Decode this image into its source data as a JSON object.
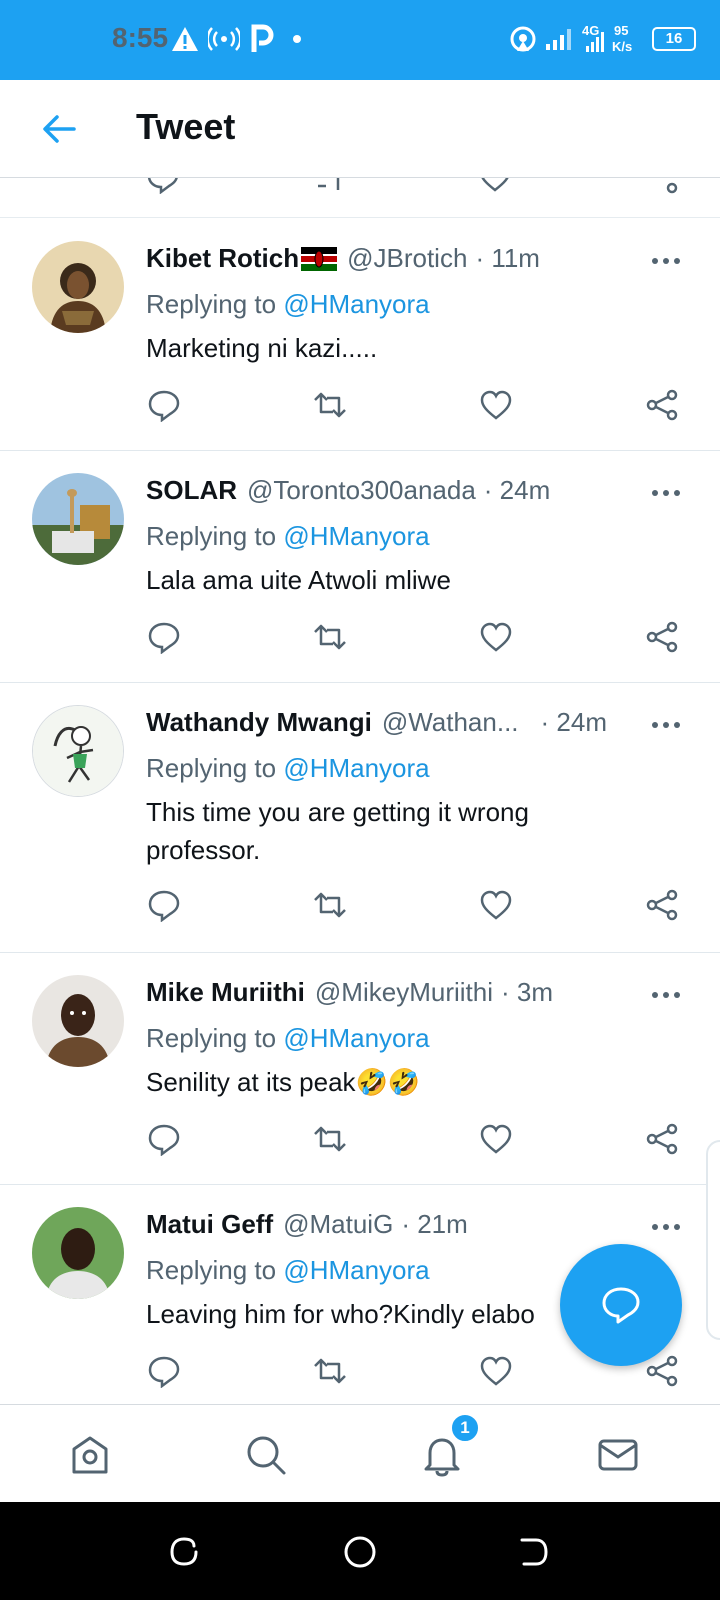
{
  "status_bar": {
    "time": "8:55",
    "net_4g": "4G",
    "speed_value": "95",
    "speed_unit": "K/s",
    "battery": "16",
    "icons": [
      "warning-icon",
      "hotspot-icon",
      "p-icon",
      "dot-icon",
      "wifi-hotspot-icon",
      "signal-icon",
      "signal-4g-icon",
      "battery-icon"
    ]
  },
  "header": {
    "title": "Tweet",
    "back_icon": "back-arrow-icon"
  },
  "tweets": [
    {
      "name": "Kibet Rotich",
      "flag": "kenya-flag",
      "handle": "@JBrotich",
      "time": "· 11m",
      "reply_prefix": "Replying to",
      "reply_to": "@HManyora",
      "text": "Marketing ni kazi....."
    },
    {
      "name": "SOLAR",
      "handle": "@Toronto300anada",
      "time": "· 24m",
      "reply_prefix": "Replying to",
      "reply_to": "@HManyora",
      "text": "Lala ama uite Atwoli mliwe"
    },
    {
      "name": "Wathandy Mwangi",
      "handle": "@Wathan...",
      "time": "· 24m",
      "reply_prefix": "Replying to",
      "reply_to": "@HManyora",
      "text": "This time you are getting it wrong professor."
    },
    {
      "name": "Mike Muriithi",
      "handle": "@MikeyMuriithi",
      "time": "· 3m",
      "reply_prefix": "Replying to",
      "reply_to": "@HManyora",
      "text": "Senility at its peak🤣🤣"
    },
    {
      "name": "Matui Geff",
      "handle": "@MatuiG",
      "time": "· 21m",
      "reply_prefix": "Replying to",
      "reply_to": "@HManyora",
      "text": "Leaving him for who?Kindly elabo"
    }
  ],
  "bottom_nav": {
    "items": [
      "home-icon",
      "search-icon",
      "notifications-icon",
      "messages-icon"
    ],
    "notification_badge": "1"
  },
  "colors": {
    "brand": "#1da1f2",
    "mention": "#1b95e0",
    "secondary_text": "#536471",
    "primary_text": "#0f1419"
  }
}
